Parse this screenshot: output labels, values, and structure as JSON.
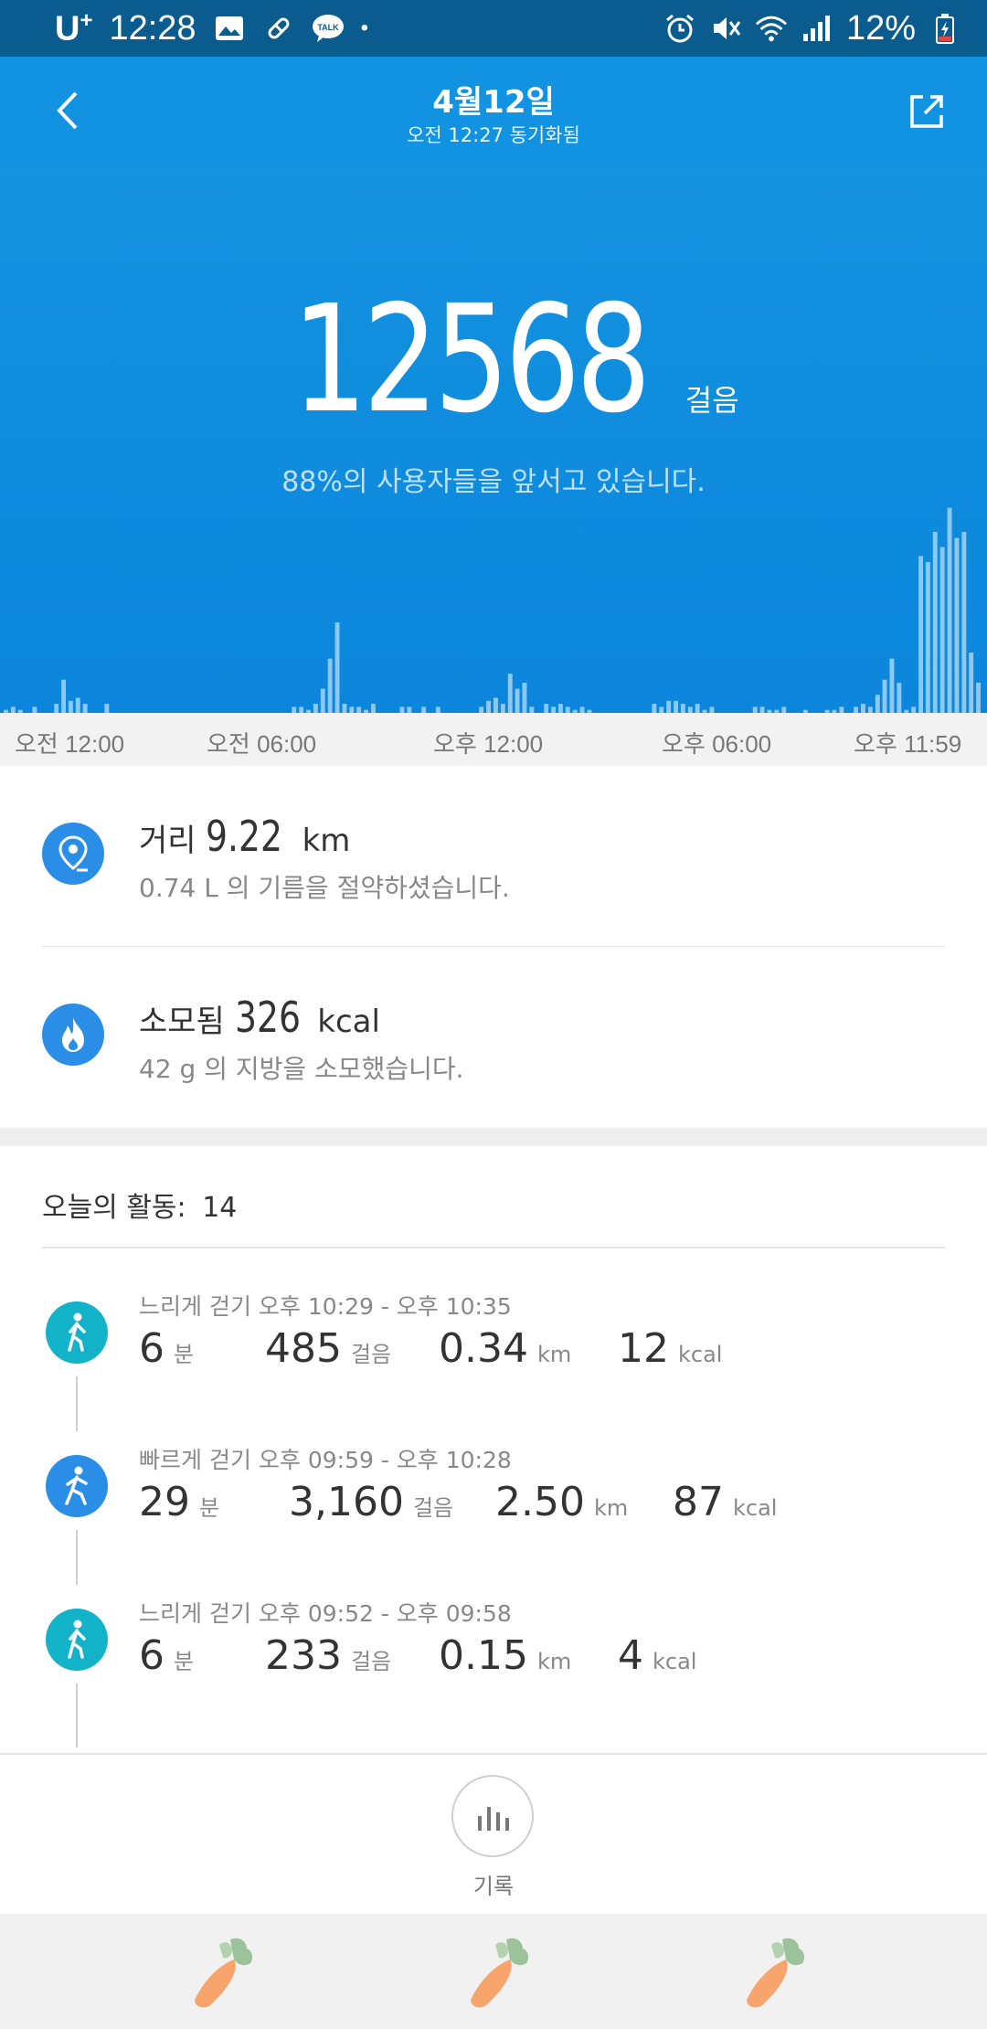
{
  "status_bar": {
    "carrier": "U",
    "carrier_sup": "+",
    "time": "12:28",
    "battery": "12%"
  },
  "header": {
    "title": "4월12일",
    "subtitle": "오전 12:27 동기화됨"
  },
  "hero": {
    "steps": "12568",
    "steps_unit": "걸음",
    "rank_text": "88%의 사용자들을 앞서고 있습니다.",
    "time_labels": [
      "오전 12:00",
      "오전 06:00",
      "오후 12:00",
      "오후 06:00",
      "오후 11:59"
    ]
  },
  "summary": {
    "distance": {
      "label": "거리",
      "value": "9.22",
      "unit": "km",
      "note": "0.74 L 의 기름을 절약하셨습니다."
    },
    "calories": {
      "label": "소모됨",
      "value": "326",
      "unit": "kcal",
      "note": "42 g 의 지방을 소모했습니다."
    }
  },
  "activities": {
    "header_label": "오늘의 활동:",
    "count": "14",
    "items": [
      {
        "title": "느리게 걷기 오후 10:29 - 오후 10:35",
        "minutes": "6",
        "minutes_unit": "분",
        "steps": "485",
        "steps_unit": "걸음",
        "distance": "0.34",
        "distance_unit": "km",
        "kcal": "12",
        "kcal_unit": "kcal",
        "color": "#12b3c8"
      },
      {
        "title": "빠르게 걷기 오후 09:59 - 오후 10:28",
        "minutes": "29",
        "minutes_unit": "분",
        "steps": "3,160",
        "steps_unit": "걸음",
        "distance": "2.50",
        "distance_unit": "km",
        "kcal": "87",
        "kcal_unit": "kcal",
        "color": "#2b8ee6"
      },
      {
        "title": "느리게 걷기 오후 09:52 - 오후 09:58",
        "minutes": "6",
        "minutes_unit": "분",
        "steps": "233",
        "steps_unit": "걸음",
        "distance": "0.15",
        "distance_unit": "km",
        "kcal": "4",
        "kcal_unit": "kcal",
        "color": "#12b3c8"
      }
    ]
  },
  "bottom": {
    "record_label": "기록"
  },
  "colors": {
    "header": "#1193e2",
    "status_bar": "#0a5c8f",
    "accent": "#2b8ee6"
  },
  "histogram_levels": [
    0.01,
    0.02,
    0.01,
    0.0,
    0.02,
    0.0,
    0.0,
    0.03,
    0.11,
    0.04,
    0.05,
    0.03,
    0.0,
    0.0,
    0.03,
    0.0,
    0.0,
    0.0,
    0.0,
    0.0,
    0.0,
    0.0,
    0.0,
    0.0,
    0.0,
    0.0,
    0.0,
    0.0,
    0.0,
    0.0,
    0.0,
    0.0,
    0.0,
    0.0,
    0.0,
    0.0,
    0.0,
    0.0,
    0.0,
    0.0,
    0.02,
    0.02,
    0.01,
    0.03,
    0.08,
    0.18,
    0.3,
    0.03,
    0.02,
    0.02,
    0.01,
    0.03,
    0.0,
    0.0,
    0.0,
    0.02,
    0.02,
    0.0,
    0.02,
    0.0,
    0.02,
    0.0,
    0.0,
    0.0,
    0.0,
    0.0,
    0.02,
    0.04,
    0.05,
    0.03,
    0.13,
    0.08,
    0.1,
    0.02,
    0.0,
    0.03,
    0.02,
    0.03,
    0.02,
    0.01,
    0.02,
    0.01,
    0.0,
    0.0,
    0.0,
    0.0,
    0.0,
    0.0,
    0.0,
    0.0,
    0.03,
    0.02,
    0.04,
    0.04,
    0.03,
    0.02,
    0.03,
    0.01,
    0.02,
    0.0,
    0.0,
    0.0,
    0.0,
    0.0,
    0.02,
    0.02,
    0.01,
    0.01,
    0.02,
    0.0,
    0.0,
    0.01,
    0.0,
    0.0,
    0.01,
    0.01,
    0.02,
    0.0,
    0.02,
    0.03,
    0.02,
    0.06,
    0.11,
    0.18,
    0.1,
    0.01,
    0.02,
    0.52,
    0.5,
    0.6,
    0.55,
    0.68,
    0.58,
    0.6,
    0.2,
    0.1
  ]
}
